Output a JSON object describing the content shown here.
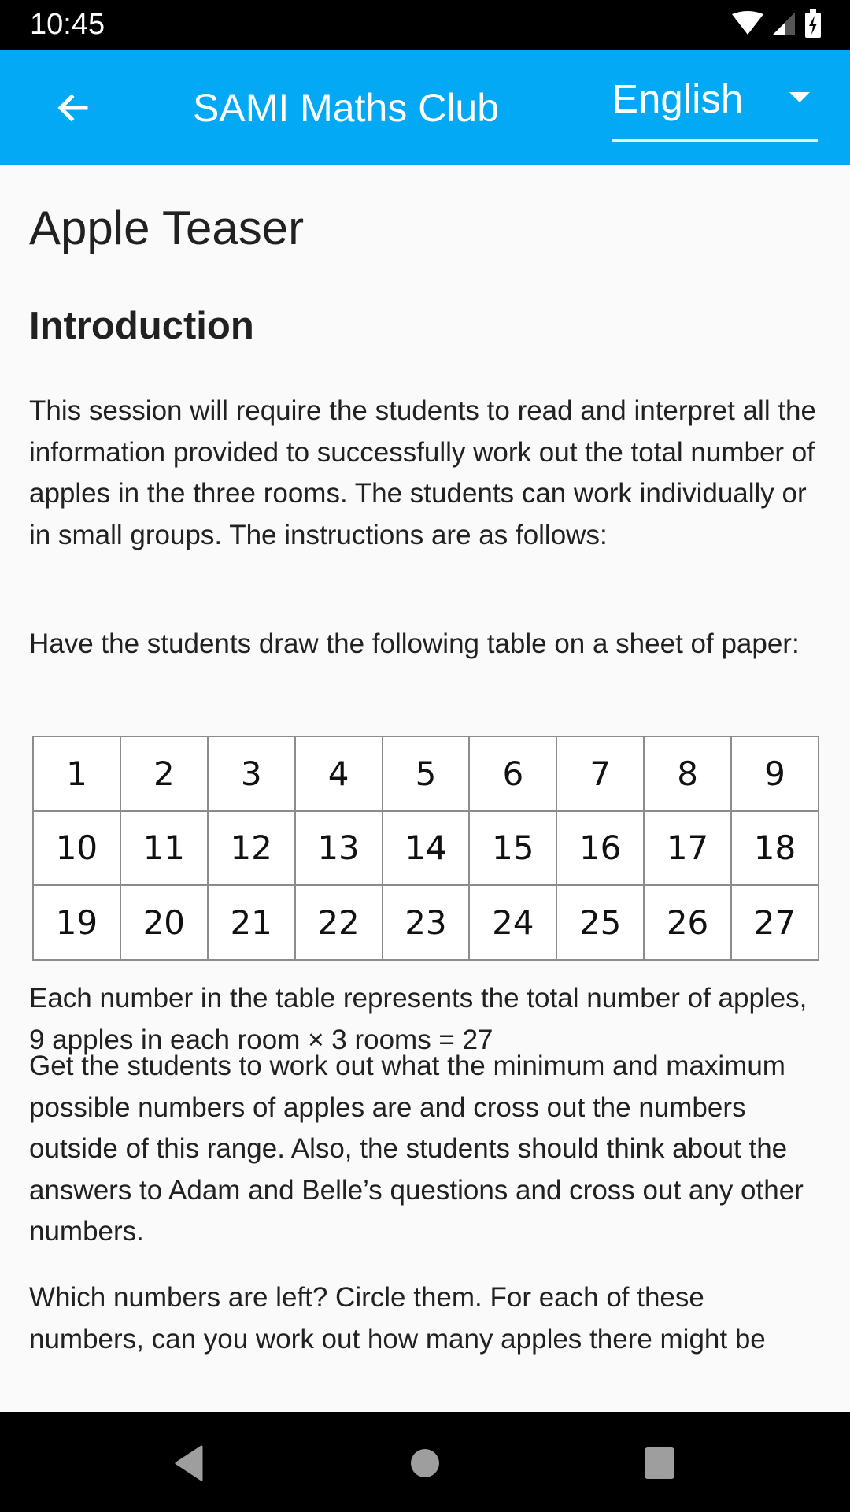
{
  "status_bar": {
    "time": "10:45",
    "icons": [
      "wifi-icon",
      "signal-icon",
      "battery-charging-icon"
    ]
  },
  "app_bar": {
    "back_icon": "arrow-back-icon",
    "title": "SAMI Maths Club",
    "language": {
      "selected": "English",
      "caret_icon": "dropdown-caret-icon"
    },
    "color": "#03a9f4"
  },
  "content": {
    "title": "Apple Teaser",
    "section_heading": "Introduction",
    "paragraphs": [
      "This session will require the students to read and interpret all the information provided to successfully work out the total number of apples in the three rooms. The students can work individually or in small groups. The instructions are as follows:",
      "Have the students draw the following table on a sheet of paper:",
      "Each number in the table represents the total number of apples, 9 apples in each room × 3 rooms = 27",
      "Get the students to work out what the minimum and maximum possible numbers of apples are and cross out the numbers outside of this range. Also, the students should think about the answers to Adam and Belle’s questions and cross out any other numbers.",
      "Which numbers are left? Circle them. For each of these numbers, can you work out how many apples there might be"
    ],
    "number_table": [
      [
        "1",
        "2",
        "3",
        "4",
        "5",
        "6",
        "7",
        "8",
        "9"
      ],
      [
        "10",
        "11",
        "12",
        "13",
        "14",
        "15",
        "16",
        "17",
        "18"
      ],
      [
        "19",
        "20",
        "21",
        "22",
        "23",
        "24",
        "25",
        "26",
        "27"
      ]
    ]
  },
  "nav_bar": {
    "back": "nav-back-icon",
    "home": "nav-home-icon",
    "recents": "nav-recents-icon"
  }
}
